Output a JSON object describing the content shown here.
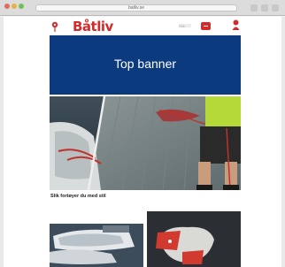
{
  "browser": {
    "url": "batliv.se"
  },
  "header": {
    "logo_text": "Båtliv",
    "search_text": "Sök",
    "icons": [
      "map-pin-icon",
      "menu-icon",
      "user-icon"
    ]
  },
  "banner": {
    "label": "Top banner",
    "background": "#0c3a7e"
  },
  "hero": {
    "caption": "Slik fortøyer du med stil"
  },
  "colors": {
    "brand_red": "#d42a2a",
    "banner_blue": "#0c3a7e"
  }
}
